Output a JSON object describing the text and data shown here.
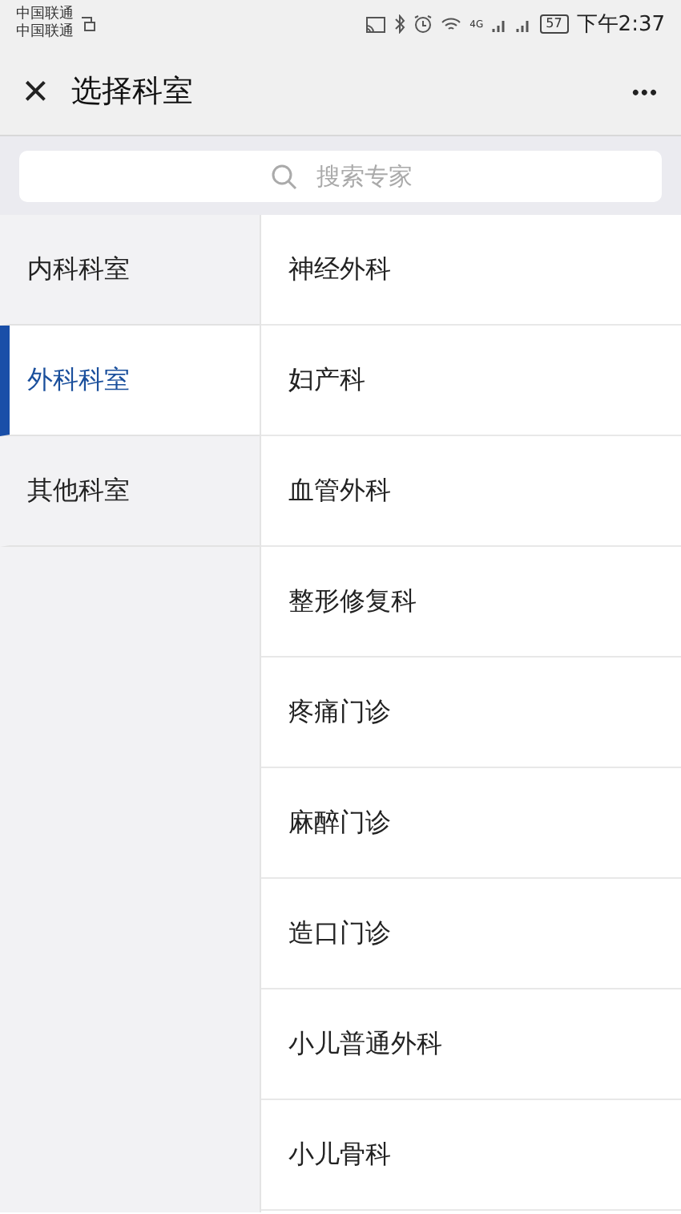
{
  "status_bar": {
    "carriers": [
      "中国联通",
      "中国联通"
    ],
    "network": "4G",
    "battery": "57",
    "time": "下午2:37"
  },
  "header": {
    "close": "×",
    "title": "选择科室",
    "more": "•••"
  },
  "search": {
    "placeholder": "搜索专家"
  },
  "categories": [
    {
      "label": "内科科室",
      "selected": false
    },
    {
      "label": "外科科室",
      "selected": true
    },
    {
      "label": "其他科室",
      "selected": false
    }
  ],
  "departments": [
    "神经外科",
    "妇产科",
    "血管外科",
    "整形修复科",
    "疼痛门诊",
    "麻醉门诊",
    "造口门诊",
    "小儿普通外科",
    "小儿骨科"
  ]
}
